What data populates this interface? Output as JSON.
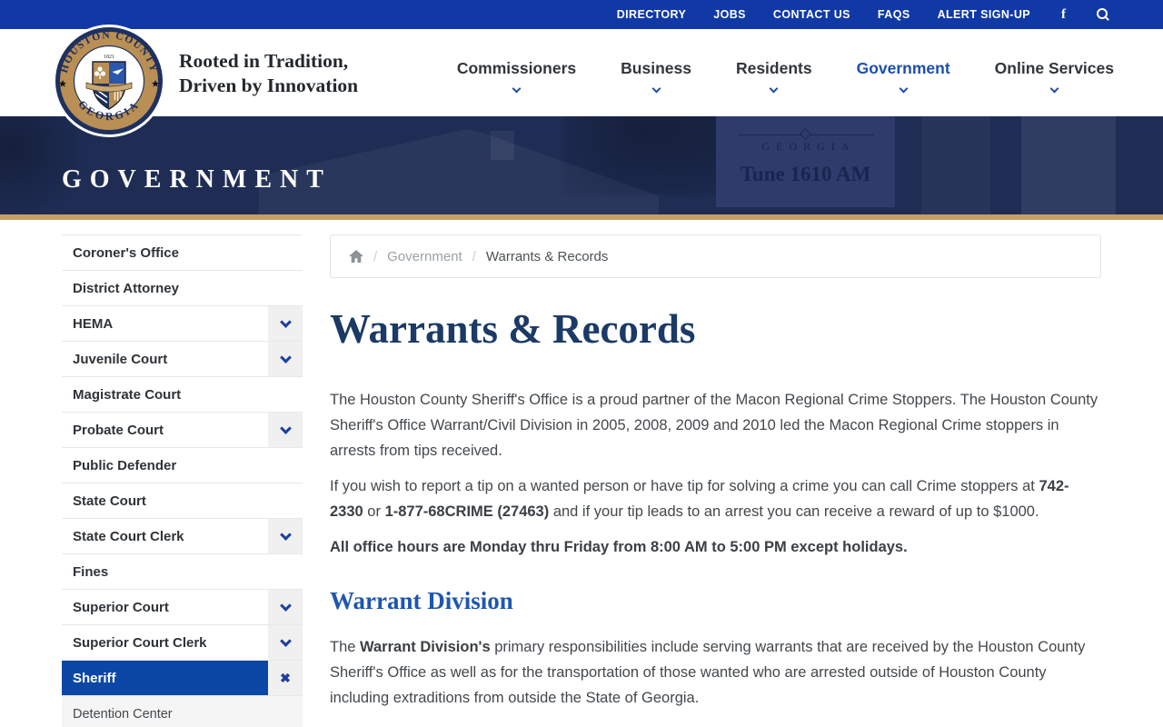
{
  "topbar": {
    "links": [
      "DIRECTORY",
      "JOBS",
      "CONTACT US",
      "FAQS",
      "ALERT SIGN-UP"
    ]
  },
  "logo": {
    "arc_top": "HOUSTON COUNTY",
    "arc_bottom": "GEORGIA",
    "year": "1821"
  },
  "header": {
    "tagline_line1": "Rooted in Tradition,",
    "tagline_line2": "Driven by Innovation",
    "nav": [
      {
        "label": "Commissioners",
        "active": false
      },
      {
        "label": "Business",
        "active": false
      },
      {
        "label": "Residents",
        "active": false
      },
      {
        "label": "Government",
        "active": true
      },
      {
        "label": "Online Services",
        "active": false
      }
    ]
  },
  "hero": {
    "title": "GOVERNMENT",
    "sign_line1": "GEORGIA",
    "sign_line2": "Tune 1610 AM"
  },
  "sidebar": {
    "items": [
      {
        "label": "Coroner's Office",
        "chevron": false
      },
      {
        "label": "District Attorney",
        "chevron": false
      },
      {
        "label": "HEMA",
        "chevron": true
      },
      {
        "label": "Juvenile Court",
        "chevron": true
      },
      {
        "label": "Magistrate Court",
        "chevron": false
      },
      {
        "label": "Probate Court",
        "chevron": true
      },
      {
        "label": "Public Defender",
        "chevron": false
      },
      {
        "label": "State Court",
        "chevron": false
      },
      {
        "label": "State Court Clerk",
        "chevron": true
      },
      {
        "label": "Fines",
        "chevron": false
      },
      {
        "label": "Superior Court",
        "chevron": true
      },
      {
        "label": "Superior Court Clerk",
        "chevron": true
      },
      {
        "label": "Sheriff",
        "chevron": false,
        "active": true,
        "close": true
      },
      {
        "label": "Detention Center",
        "chevron": false,
        "sub": true
      }
    ]
  },
  "breadcrumb": {
    "separator": "/",
    "link": "Government",
    "current": "Warrants & Records"
  },
  "content": {
    "title": "Warrants & Records",
    "p1": "The Houston County Sheriff's Office is a proud partner of the Macon Regional Crime Stoppers. The Houston County Sheriff's Office Warrant/Civil Division in 2005, 2008, 2009 and 2010 led the Macon Regional Crime stoppers in arrests from tips received.",
    "p2_pre": "If you wish to report a tip on a wanted person or have tip for solving a crime you can call Crime stoppers at ",
    "p2_bold1": "742-2330",
    "p2_mid": " or ",
    "p2_bold2": "1-877-68CRIME (27463)",
    "p2_post": " and if your tip leads to an arrest you can receive a reward of up to $1000.",
    "p3": "All office hours are Monday thru Friday from 8:00 AM to 5:00 PM except holidays.",
    "section_title": "Warrant Division",
    "p4_pre": "The ",
    "p4_bold": "Warrant Division's",
    "p4_post": " primary responsibilities include serving warrants that are received by the Houston County Sheriff's Office as well as for the transportation of those wanted who are arrested outside of Houston County including extraditions from outside the State of Georgia."
  },
  "colors": {
    "topbar_blue": "#1139a6",
    "active_item_blue": "#0d47a6",
    "nav_active_blue": "#1b4fae",
    "banner_navy": "#1f2d55",
    "tan_accent": "#c7a066",
    "heading_navy": "#1b3a66",
    "heading_blue": "#1e56b0",
    "body_text": "#43484d",
    "chevron_blue": "#1c3fa0"
  },
  "icons": {
    "facebook": "f",
    "close": "✖"
  }
}
